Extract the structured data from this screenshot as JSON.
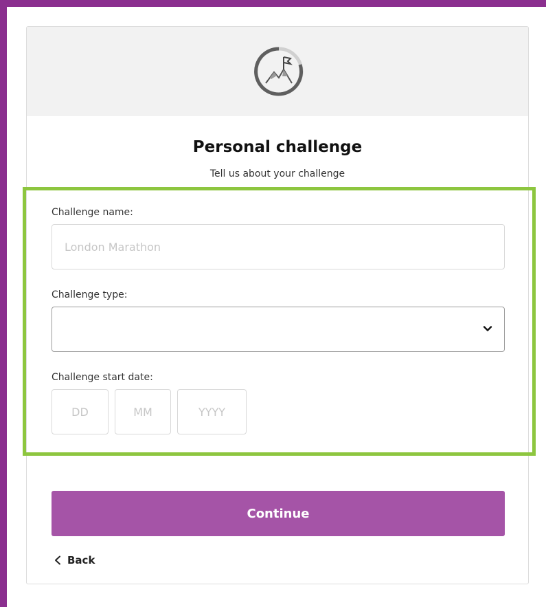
{
  "header": {
    "icon": "mountain-flag-icon"
  },
  "form": {
    "title": "Personal challenge",
    "subtitle": "Tell us about your challenge",
    "challenge_name": {
      "label": "Challenge name:",
      "value": "",
      "placeholder": "London Marathon"
    },
    "challenge_type": {
      "label": "Challenge type:",
      "selected": "",
      "icon": "chevron-down-icon"
    },
    "start_date": {
      "label": "Challenge start date:",
      "day_placeholder": "DD",
      "month_placeholder": "MM",
      "year_placeholder": "YYYY"
    }
  },
  "actions": {
    "continue_label": "Continue",
    "back_label": "Back",
    "back_icon": "chevron-left-icon"
  },
  "colors": {
    "page_border": "#8b2f8f",
    "highlight": "#8dc63f",
    "button": "#a554a7",
    "header_bg": "#f2f2f2"
  }
}
